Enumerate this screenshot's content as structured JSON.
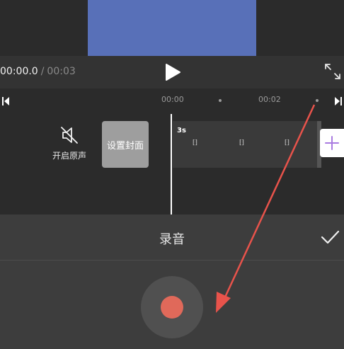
{
  "player": {
    "current_time": "00:00.0",
    "separator": "/",
    "total_time": "00:03"
  },
  "ruler": {
    "ticks": [
      "00:00",
      "00:02"
    ]
  },
  "track": {
    "mute_label": "开启原声",
    "cover_label": "设置封面",
    "clip_duration": "3s",
    "clip_glyphs": [
      "⁅⁆",
      "⁅⁆",
      "⁅⁆"
    ]
  },
  "record": {
    "title": "录音"
  },
  "colors": {
    "video_preview": "#5870b8",
    "record_dot": "#e0695a",
    "annotation_arrow": "#e8534b",
    "add_plus": "#a97be0"
  },
  "icons": [
    "play-icon",
    "fullscreen-icon",
    "skip-to-start-icon",
    "skip-to-end-icon",
    "speaker-muted-icon",
    "plus-icon",
    "check-icon",
    "record-icon"
  ]
}
